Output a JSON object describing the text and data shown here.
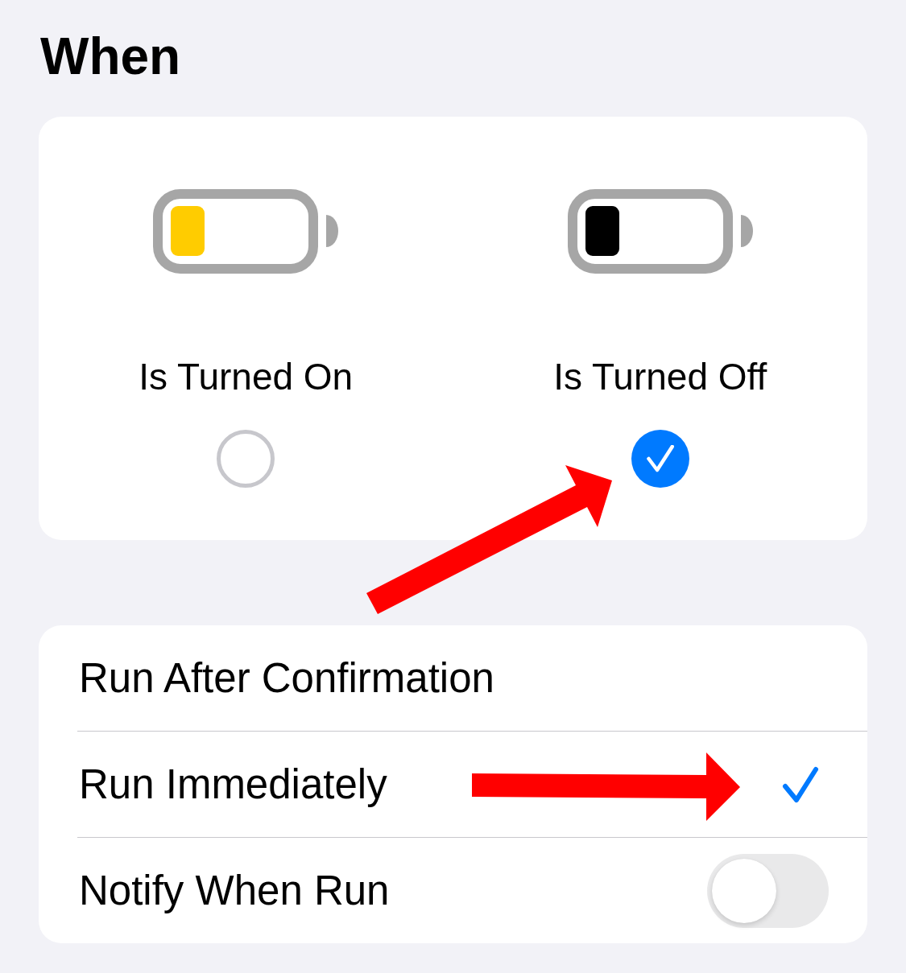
{
  "title": "When",
  "options": [
    {
      "label": "Is Turned On",
      "color": "#ffcc00",
      "selected": false
    },
    {
      "label": "Is Turned Off",
      "color": "#000000",
      "selected": true
    }
  ],
  "rows": [
    {
      "kind": "choice",
      "label": "Run After Confirmation",
      "selected": false
    },
    {
      "kind": "choice",
      "label": "Run Immediately",
      "selected": true
    },
    {
      "kind": "toggle",
      "label": "Notify When Run",
      "on": false
    }
  ],
  "annotations": [
    {
      "kind": "diagonal"
    },
    {
      "kind": "horizontal"
    }
  ]
}
